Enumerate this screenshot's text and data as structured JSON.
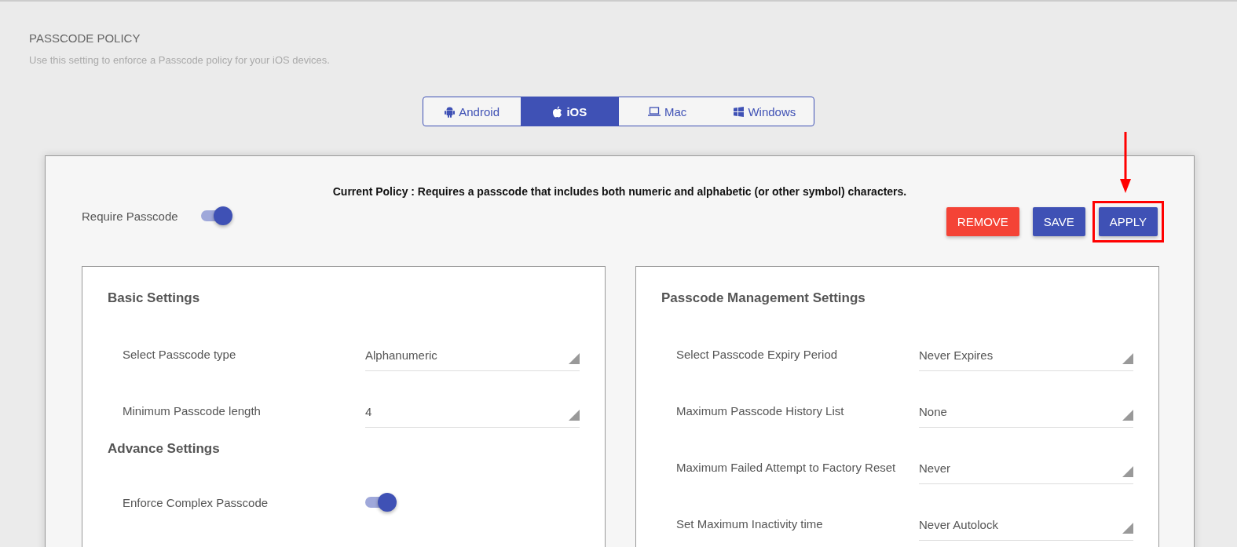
{
  "header": {
    "title": "PASSCODE POLICY",
    "subtitle": "Use this setting to enforce a Passcode policy for your iOS devices."
  },
  "platform_tabs": [
    {
      "label": "Android",
      "selected": false
    },
    {
      "label": "iOS",
      "selected": true
    },
    {
      "label": "Mac",
      "selected": false
    },
    {
      "label": "Windows",
      "selected": false
    }
  ],
  "policy": {
    "current_policy": "Current Policy : Requires a passcode that includes both numeric and alphabetic (or other symbol) characters.",
    "require_passcode": {
      "label": "Require Passcode",
      "on": true
    },
    "buttons": [
      {
        "label": "REMOVE",
        "kind": "danger",
        "highlighted": false
      },
      {
        "label": "SAVE",
        "kind": "primary",
        "highlighted": false
      },
      {
        "label": "APPLY",
        "kind": "primary",
        "highlighted": true
      }
    ]
  },
  "panels": [
    {
      "sections": [
        {
          "title": "Basic Settings",
          "rows": [
            {
              "kind": "select",
              "label": "Select Passcode type",
              "value": "Alphanumeric"
            },
            {
              "kind": "select",
              "label": "Minimum Passcode length",
              "value": "4"
            }
          ]
        },
        {
          "title": "Advance Settings",
          "rows": [
            {
              "kind": "toggle",
              "label": "Enforce Complex Passcode",
              "on": true
            }
          ]
        }
      ]
    },
    {
      "sections": [
        {
          "title": "Passcode Management Settings",
          "rows": [
            {
              "kind": "select",
              "label": "Select Passcode Expiry Period",
              "value": "Never Expires"
            },
            {
              "kind": "select",
              "label": "Maximum Passcode History List",
              "value": "None"
            },
            {
              "kind": "select",
              "label": "Maximum Failed Attempt to Factory Reset",
              "value": "Never"
            },
            {
              "kind": "select",
              "label": "Set Maximum Inactivity time",
              "value": "Never Autolock"
            }
          ]
        }
      ]
    }
  ]
}
